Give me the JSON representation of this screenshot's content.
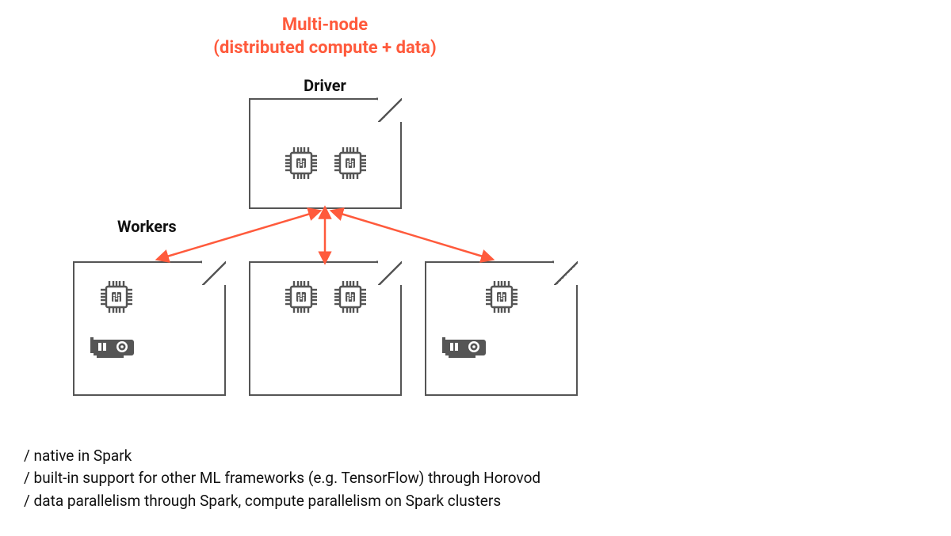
{
  "title_line1": "Multi-node",
  "title_line2": "(distributed compute + data)",
  "driver_label": "Driver",
  "workers_label": "Workers",
  "bullets": [
    "/ native in Spark",
    "/ built-in support for other ML frameworks (e.g. TensorFlow) through Horovod",
    "/ data parallelism through Spark, compute parallelism on Spark clusters"
  ],
  "colors": {
    "accent": "#ff5a3c",
    "node_border": "#555555",
    "icon": "#555555"
  },
  "nodes": {
    "driver": {
      "cpus": 2,
      "gpus": 0
    },
    "workers": [
      {
        "cpus": 1,
        "gpus": 1
      },
      {
        "cpus": 2,
        "gpus": 0
      },
      {
        "cpus": 1,
        "gpus": 1
      }
    ]
  },
  "icon_names": {
    "cpu": "cpu-chip-icon",
    "gpu": "gpu-card-icon"
  }
}
